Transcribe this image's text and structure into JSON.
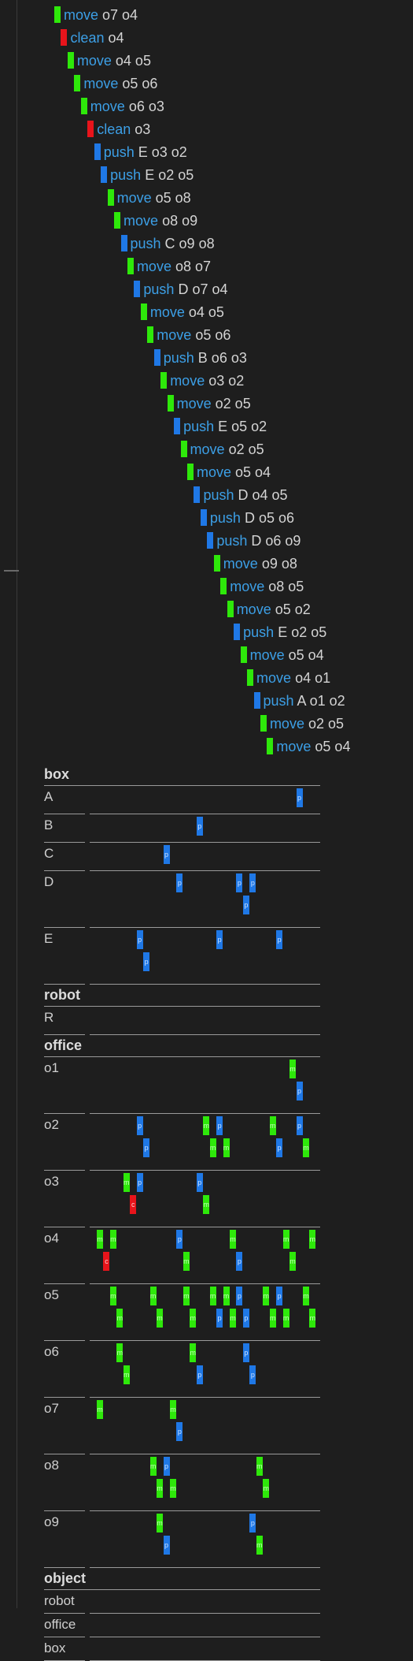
{
  "plan": [
    {
      "action": "move",
      "args": "o7 o4",
      "color": "green"
    },
    {
      "action": "clean",
      "args": "o4",
      "color": "red"
    },
    {
      "action": "move",
      "args": "o4 o5",
      "color": "green"
    },
    {
      "action": "move",
      "args": "o5 o6",
      "color": "green"
    },
    {
      "action": "move",
      "args": "o6 o3",
      "color": "green"
    },
    {
      "action": "clean",
      "args": "o3",
      "color": "red"
    },
    {
      "action": "push",
      "args": "E o3 o2",
      "color": "blue"
    },
    {
      "action": "push",
      "args": "E o2 o5",
      "color": "blue"
    },
    {
      "action": "move",
      "args": "o5 o8",
      "color": "green"
    },
    {
      "action": "move",
      "args": "o8 o9",
      "color": "green"
    },
    {
      "action": "push",
      "args": "C o9 o8",
      "color": "blue"
    },
    {
      "action": "move",
      "args": "o8 o7",
      "color": "green"
    },
    {
      "action": "push",
      "args": "D o7 o4",
      "color": "blue"
    },
    {
      "action": "move",
      "args": "o4 o5",
      "color": "green"
    },
    {
      "action": "move",
      "args": "o5 o6",
      "color": "green"
    },
    {
      "action": "push",
      "args": "B o6 o3",
      "color": "blue"
    },
    {
      "action": "move",
      "args": "o3 o2",
      "color": "green"
    },
    {
      "action": "move",
      "args": "o2 o5",
      "color": "green"
    },
    {
      "action": "push",
      "args": "E o5 o2",
      "color": "blue"
    },
    {
      "action": "move",
      "args": "o2 o5",
      "color": "green"
    },
    {
      "action": "move",
      "args": "o5 o4",
      "color": "green"
    },
    {
      "action": "push",
      "args": "D o4 o5",
      "color": "blue"
    },
    {
      "action": "push",
      "args": "D o5 o6",
      "color": "blue"
    },
    {
      "action": "push",
      "args": "D o6 o9",
      "color": "blue"
    },
    {
      "action": "move",
      "args": "o9 o8",
      "color": "green"
    },
    {
      "action": "move",
      "args": "o8 o5",
      "color": "green"
    },
    {
      "action": "move",
      "args": "o5 o2",
      "color": "green"
    },
    {
      "action": "push",
      "args": "E o2 o5",
      "color": "blue"
    },
    {
      "action": "move",
      "args": "o5 o4",
      "color": "green"
    },
    {
      "action": "move",
      "args": "o4 o1",
      "color": "green"
    },
    {
      "action": "push",
      "args": "A o1 o2",
      "color": "blue"
    },
    {
      "action": "move",
      "args": "o2 o5",
      "color": "green"
    },
    {
      "action": "move",
      "args": "o5 o4",
      "color": "green"
    }
  ],
  "colors": {
    "green": "#2ee80a",
    "red": "#e8141b",
    "blue": "#1f78e6",
    "verb": "#3c9fe6",
    "background": "#1e1e1e"
  },
  "marker_letters": {
    "move": "m",
    "clean": "c",
    "push": "p"
  },
  "sections": [
    {
      "title": "box",
      "rows": [
        {
          "label": "A",
          "lines": [
            [
              30
            ]
          ]
        },
        {
          "label": "B",
          "lines": [
            [
              15
            ]
          ]
        },
        {
          "label": "C",
          "lines": [
            [
              10
            ]
          ]
        },
        {
          "label": "D",
          "lines": [
            [
              12,
              21,
              23
            ],
            [
              22
            ]
          ]
        },
        {
          "label": "E",
          "lines": [
            [
              6,
              18,
              27
            ],
            [
              7
            ]
          ]
        }
      ]
    },
    {
      "title": "robot",
      "rows": [
        {
          "label": "R",
          "lines": [
            []
          ]
        }
      ]
    },
    {
      "title": "office",
      "rows": [
        {
          "label": "o1",
          "lines": [
            [
              29
            ],
            [
              30
            ]
          ]
        },
        {
          "label": "o2",
          "lines": [
            [
              6,
              16,
              18,
              26,
              30
            ],
            [
              7,
              17,
              19,
              27,
              31
            ]
          ]
        },
        {
          "label": "o3",
          "lines": [
            [
              4,
              6,
              15
            ],
            [
              5,
              16
            ]
          ]
        },
        {
          "label": "o4",
          "lines": [
            [
              0,
              2,
              12,
              20,
              28,
              32
            ],
            [
              1,
              13,
              21,
              29
            ]
          ]
        },
        {
          "label": "o5",
          "lines": [
            [
              2,
              8,
              13,
              17,
              19,
              21,
              25,
              27,
              31
            ],
            [
              3,
              9,
              14,
              18,
              20,
              22,
              26,
              28,
              32
            ]
          ]
        },
        {
          "label": "o6",
          "lines": [
            [
              3,
              14,
              22
            ],
            [
              4,
              15,
              23
            ]
          ]
        },
        {
          "label": "o7",
          "lines": [
            [
              0,
              11
            ],
            [
              12
            ]
          ]
        },
        {
          "label": "o8",
          "lines": [
            [
              8,
              10,
              24
            ],
            [
              9,
              11,
              25
            ]
          ]
        },
        {
          "label": "o9",
          "lines": [
            [
              9,
              23
            ],
            [
              10,
              24
            ]
          ]
        }
      ]
    },
    {
      "title": "object",
      "rows": [
        {
          "label": "robot",
          "lines": []
        },
        {
          "label": "office",
          "lines": []
        },
        {
          "label": "box",
          "lines": []
        }
      ]
    }
  ]
}
